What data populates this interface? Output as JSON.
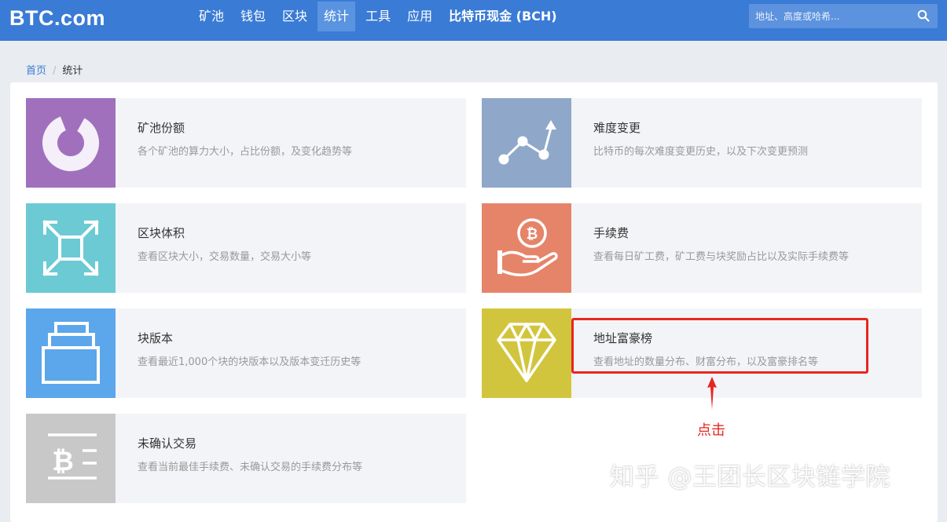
{
  "header": {
    "logo": "BTC.com",
    "nav": [
      "矿池",
      "钱包",
      "区块",
      "统计",
      "工具",
      "应用",
      "比特币现金 (BCH)"
    ],
    "search_placeholder": "地址、高度或哈希..."
  },
  "breadcrumb": {
    "home": "首页",
    "current": "统计"
  },
  "cards": [
    {
      "title": "矿池份额",
      "desc": "各个矿池的算力大小，占比份额，及变化趋势等",
      "color": "#a070bd",
      "icon": "pie-chart-icon"
    },
    {
      "title": "难度变更",
      "desc": "比特币的每次难度变更历史，以及下次变更预测",
      "color": "#8fa8c9",
      "icon": "line-trend-icon"
    },
    {
      "title": "区块体积",
      "desc": "查看区块大小，交易数量，交易大小等",
      "color": "#6ccad4",
      "icon": "expand-arrows-icon"
    },
    {
      "title": "手续费",
      "desc": "查看每日矿工费，矿工费与块奖励占比以及实际手续费等",
      "color": "#e6846a",
      "icon": "bitcoin-hand-icon"
    },
    {
      "title": "块版本",
      "desc": "查看最近1,000个块的块版本以及版本变迁历史等",
      "color": "#5ca6ec",
      "icon": "stack-layers-icon"
    },
    {
      "title": "地址富豪榜",
      "desc": "查看地址的数量分布、财富分布，以及富豪排名等",
      "color": "#d2c53e",
      "icon": "diamond-icon"
    },
    {
      "title": "未确认交易",
      "desc": "查看当前最佳手续费、未确认交易的手续费分布等",
      "color": "#c8c8c8",
      "icon": "bitcoin-lines-icon"
    }
  ],
  "annotation": {
    "label": "点击",
    "color": "#e8261f"
  },
  "watermark": "知乎 @王团长区块链学院"
}
